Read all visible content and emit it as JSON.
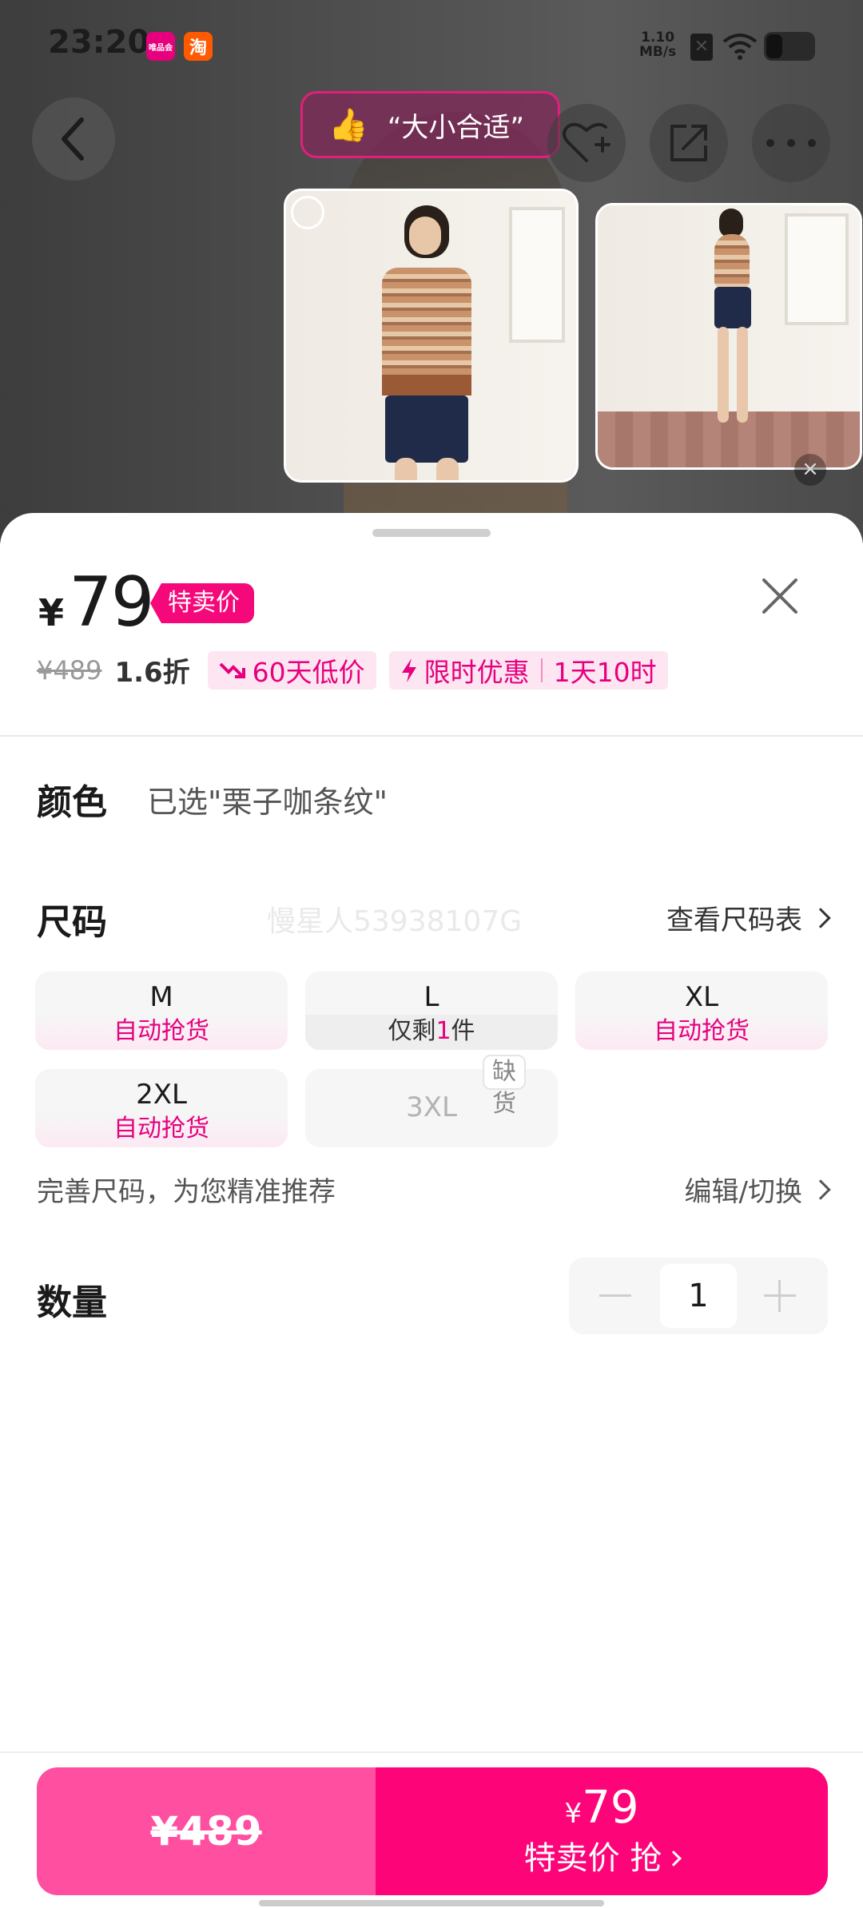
{
  "status_bar": {
    "time": "23:20",
    "app_badge_vip": "唯品会",
    "app_badge_tao": "淘",
    "net_speed_value": "1.10",
    "net_speed_unit": "MB/s"
  },
  "review_chip": {
    "text": "“大小合适”"
  },
  "price": {
    "currency": "¥",
    "current": "79",
    "tag": "特卖价",
    "original": "¥489",
    "discount": "1.6折",
    "low_price_badge": "60天低价",
    "limited_offer": "限时优惠",
    "countdown": "1天10时"
  },
  "color": {
    "title": "颜色",
    "selected": "已选\"栗子咖条纹\""
  },
  "size": {
    "title": "尺码",
    "watermark": "慢星人53938107G",
    "chart_link": "查看尺码表",
    "options": [
      {
        "name": "M",
        "sub": "自动抢货"
      },
      {
        "name": "L",
        "sub_prefix": "仅剩",
        "sub_count": "1",
        "sub_suffix": "件"
      },
      {
        "name": "XL",
        "sub": "自动抢货"
      },
      {
        "name": "2XL",
        "sub": "自动抢货"
      },
      {
        "name": "3XL",
        "badge": "缺货"
      }
    ],
    "hint": "完善尺码，为您精准推荐",
    "edit_link": "编辑/切换"
  },
  "quantity": {
    "title": "数量",
    "value": "1"
  },
  "buy_bar": {
    "original_price": "¥489",
    "price_currency": "¥",
    "price": "79",
    "cta": "特卖价 抢"
  },
  "colors": {
    "accent": "#fe0479",
    "accent_light": "#ff4fa0",
    "pill_bg": "#fde6f1"
  }
}
